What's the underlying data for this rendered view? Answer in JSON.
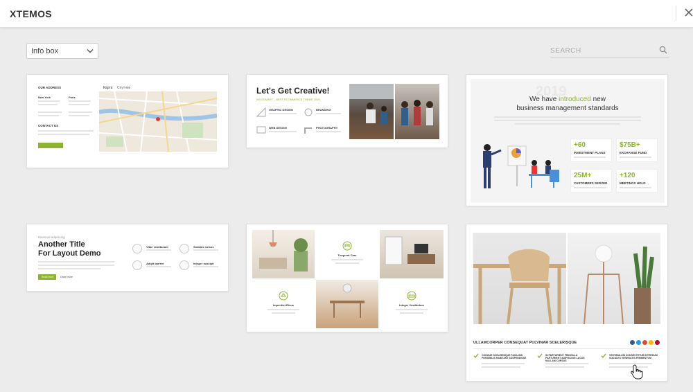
{
  "header": {
    "brand": "XTEMOS",
    "close_icon": "close-icon"
  },
  "filter": {
    "selected": "Info box",
    "icon": "chevron-down-icon"
  },
  "search": {
    "placeholder": "SEARCH",
    "icon": "search-icon"
  },
  "colors": {
    "accent_green": "#8bb52f",
    "modal_bg": "#ececec",
    "card_bg": "#ffffff",
    "map_blue": "#9fc4e6",
    "header_bg": "#ffffff"
  },
  "cards": [
    {
      "id": "card-address",
      "heading": "OUR ADDRESS",
      "city_1": "New York",
      "city_2": "Paris",
      "contact_heading": "CONTACT US",
      "map_tab_1": "Карта",
      "map_tab_2": "Спутник"
    },
    {
      "id": "card-creative",
      "title": "Let's Get Creative!",
      "subtitle": "WOODMART – BEST ECOMMERCE THEME 2019",
      "features": [
        "GRAPHIC DESIGN",
        "BRANDING",
        "WEB DESIGN",
        "PHOTOGRAPHY"
      ]
    },
    {
      "id": "card-business",
      "title_part_1": "We have",
      "title_highlight": "introduced",
      "title_part_2": "new",
      "title_line_2": "business management standards",
      "watermark": "2019",
      "stats": [
        {
          "value": "+60",
          "label": "INVESTMENT PLANS"
        },
        {
          "value": "$75B+",
          "label": "EXCHANGE FUND"
        },
        {
          "value": "25M+",
          "label": "CUSTOMERS SERVED"
        },
        {
          "value": "+120",
          "label": "MEETINGS HOLD"
        }
      ]
    },
    {
      "id": "card-another",
      "eyebrow": "Eiusmod adipiscing",
      "title_line_1": "Another Title",
      "title_line_2": "For Layout Demo",
      "button": "Read more",
      "link": "Learn more",
      "features": [
        "Vitae vestibulum",
        "Sodales cursus",
        "Adipit laoreet",
        "Integer suscipit"
      ]
    },
    {
      "id": "card-interior",
      "labels": [
        "Torquent Cras",
        "Imperdiet Risus",
        "Integer Vestibulum"
      ]
    },
    {
      "id": "card-furniture",
      "heading": "ULLAMCORPER CONSEQUAT PULVINAR SCELERISQUE",
      "features": [
        "CONGUE SCELERISQUE FACILISIS PERSIMILIS HABITANT SUSPENDISSE",
        "IN PARTURIENT FRINGILLA PARTURIENT ADIPISCING LACUS NULLAM CURSUS",
        "VESTIBULUM CONSECTETUR INTERDUM SODALES VENENATIS FERMENTUM"
      ],
      "social_colors": [
        "#3b5998",
        "#1da1f2",
        "#dd4b39",
        "#ffb300",
        "#bd081c"
      ]
    }
  ]
}
